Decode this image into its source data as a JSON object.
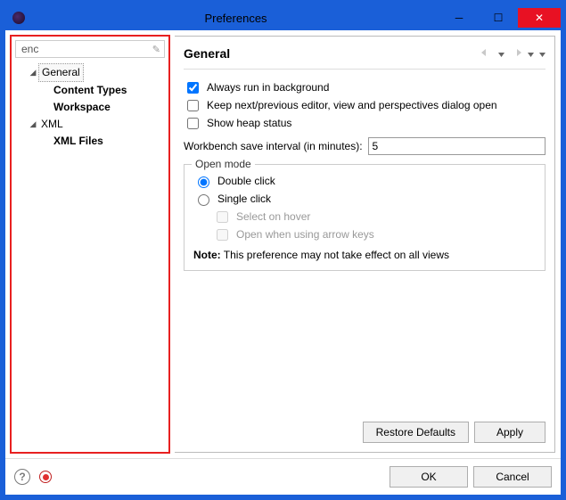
{
  "window": {
    "title": "Preferences"
  },
  "sidebar": {
    "filter": "enc",
    "items": {
      "general": "General",
      "content_types": "Content Types",
      "workspace": "Workspace",
      "xml": "XML",
      "xml_files": "XML Files"
    }
  },
  "page": {
    "heading": "General",
    "always_bg": "Always run in background",
    "keep_dialog": "Keep next/previous editor, view and perspectives dialog open",
    "heap": "Show heap status",
    "save_interval_label": "Workbench save interval (in minutes):",
    "save_interval_value": "5",
    "open_mode": {
      "legend": "Open mode",
      "double": "Double click",
      "single": "Single click",
      "hover": "Select on hover",
      "arrow": "Open when using arrow keys",
      "note_label": "Note:",
      "note_text": " This preference may not take effect on all views"
    }
  },
  "buttons": {
    "restore": "Restore Defaults",
    "apply": "Apply",
    "ok": "OK",
    "cancel": "Cancel"
  }
}
